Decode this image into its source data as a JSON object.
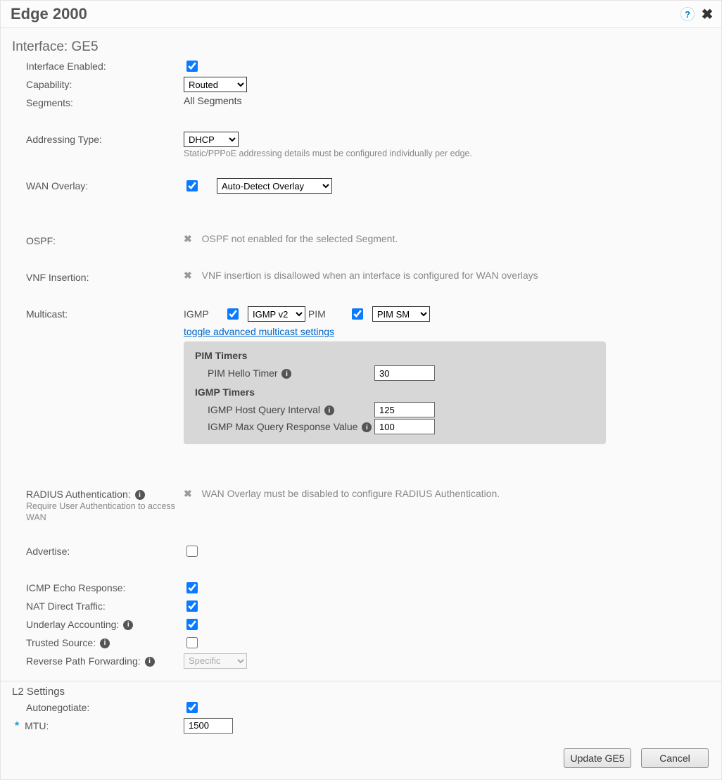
{
  "header": {
    "title": "Edge 2000"
  },
  "interface": {
    "title": "Interface: GE5",
    "labels": {
      "enabled": "Interface Enabled:",
      "capability": "Capability:",
      "segments": "Segments:",
      "addressing": "Addressing Type:",
      "addressing_note": "Static/PPPoE addressing details must be configured individually per edge.",
      "wan_overlay": "WAN Overlay:",
      "ospf": "OSPF:",
      "vnf": "VNF Insertion:",
      "multicast": "Multicast:",
      "radius": "RADIUS Authentication:",
      "radius_sub": "Require User Authentication to access WAN",
      "advertise": "Advertise:",
      "icmp": "ICMP Echo Response:",
      "nat": "NAT Direct Traffic:",
      "underlay": "Underlay Accounting:",
      "trusted": "Trusted Source:",
      "rpf": "Reverse Path Forwarding:"
    },
    "values": {
      "capability": "Routed",
      "segments": "All Segments",
      "addressing": "DHCP",
      "wan_overlay_mode": "Auto-Detect Overlay",
      "ospf_msg": "OSPF not enabled for the selected Segment.",
      "vnf_msg": "VNF insertion is disallowed when an interface is configured for WAN overlays",
      "radius_msg": "WAN Overlay must be disabled to configure RADIUS Authentication.",
      "rpf": "Specific"
    },
    "multicast": {
      "igmp_label": "IGMP",
      "igmp_version": "IGMP v2",
      "pim_label": "PIM",
      "pim_mode": "PIM SM",
      "toggle": "toggle advanced multicast settings",
      "pim_timers_head": "PIM Timers",
      "pim_hello_label": "PIM Hello Timer",
      "pim_hello": "30",
      "igmp_timers_head": "IGMP Timers",
      "host_query_label": "IGMP Host Query Interval",
      "host_query": "125",
      "max_query_label": "IGMP Max Query Response Value",
      "max_query": "100"
    }
  },
  "l2": {
    "title": "L2 Settings",
    "autoneg_label": "Autonegotiate:",
    "mtu_label": "MTU:",
    "mtu": "1500"
  },
  "footer": {
    "update": "Update GE5",
    "cancel": "Cancel"
  }
}
